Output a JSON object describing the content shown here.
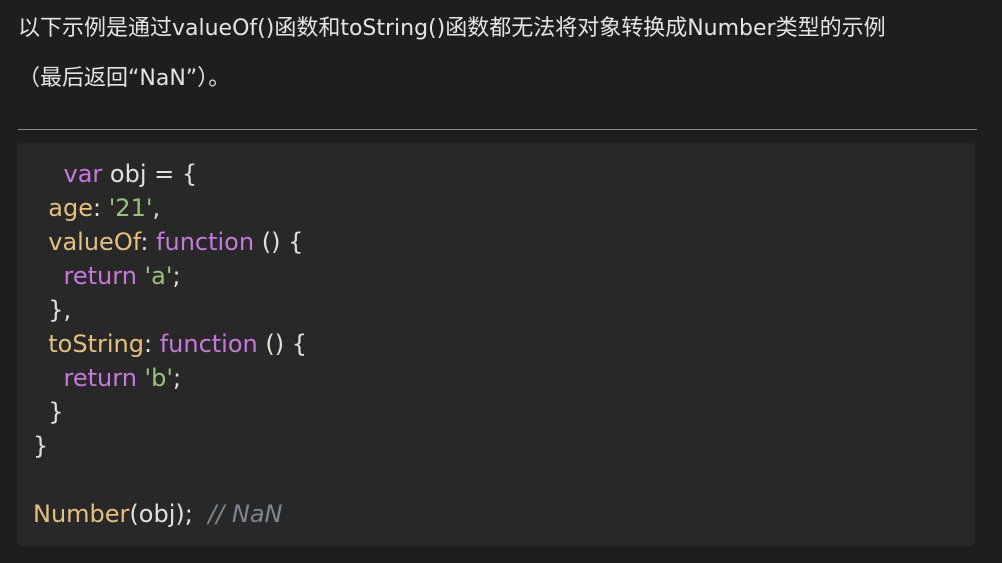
{
  "intro": {
    "line1": "以下示例是通过valueOf()函数和toString()函数都无法将对象转换成Number类型的示例",
    "line2": "（最后返回“NaN”）。"
  },
  "code": {
    "l1_kw": "var",
    "l1_rest": " obj = {",
    "l2_prop": "age",
    "l2_colon": ": ",
    "l2_str": "'21'",
    "l2_end": ",",
    "l3_prop": "valueOf",
    "l3_colon": ": ",
    "l3_kw": "function",
    "l3_end": " () {",
    "l4_kw": "return",
    "l4_sp": " ",
    "l4_str": "'a'",
    "l4_end": ";",
    "l5": "},",
    "l6_prop": "toString",
    "l6_colon": ": ",
    "l6_kw": "function",
    "l6_end": " () {",
    "l7_kw": "return",
    "l7_sp": " ",
    "l7_str": "'b'",
    "l7_end": ";",
    "l8": "}",
    "l9": "}",
    "l11_fn": "Number",
    "l11_rest": "(obj);  ",
    "l11_comment": "// NaN"
  },
  "colors": {
    "background": "#1e1e1e",
    "code_background": "#282828",
    "keyword": "#c678dd",
    "property": "#e5c07b",
    "string": "#98c379",
    "comment": "#7f848e"
  }
}
